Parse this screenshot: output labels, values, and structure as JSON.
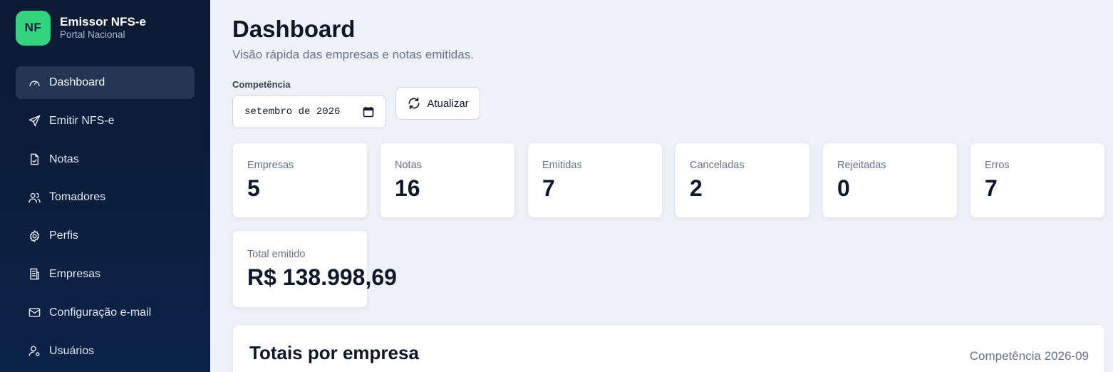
{
  "brand": {
    "logo_text": "NF",
    "title": "Emissor NFS-e",
    "subtitle": "Portal Nacional"
  },
  "sidebar": {
    "items": [
      {
        "label": "Dashboard",
        "icon": "gauge-icon",
        "active": true
      },
      {
        "label": "Emitir NFS-e",
        "icon": "send-icon",
        "active": false
      },
      {
        "label": "Notas",
        "icon": "file-icon",
        "active": false
      },
      {
        "label": "Tomadores",
        "icon": "users-icon",
        "active": false
      },
      {
        "label": "Perfis",
        "icon": "gear-icon",
        "active": false
      },
      {
        "label": "Empresas",
        "icon": "building-icon",
        "active": false
      },
      {
        "label": "Configuração e-mail",
        "icon": "mail-icon",
        "active": false
      },
      {
        "label": "Usuários",
        "icon": "user-gear-icon",
        "active": false
      }
    ]
  },
  "page": {
    "title": "Dashboard",
    "subtitle": "Visão rápida das empresas e notas emitidas.",
    "competencia_label": "Competência",
    "competencia_value": "setembro de 2026",
    "refresh_label": "Atualizar"
  },
  "stats": [
    {
      "label": "Empresas",
      "value": "5"
    },
    {
      "label": "Notas",
      "value": "16"
    },
    {
      "label": "Emitidas",
      "value": "7"
    },
    {
      "label": "Canceladas",
      "value": "2"
    },
    {
      "label": "Rejeitadas",
      "value": "0"
    },
    {
      "label": "Erros",
      "value": "7"
    }
  ],
  "total": {
    "label": "Total emitido",
    "value": "R$ 138.998,69"
  },
  "panel": {
    "title": "Totais por empresa",
    "competencia": "Competência 2026-09"
  },
  "colors": {
    "accent": "#34d37f",
    "sidebar_bg": "#0c1a33",
    "active_item": "#233552"
  }
}
